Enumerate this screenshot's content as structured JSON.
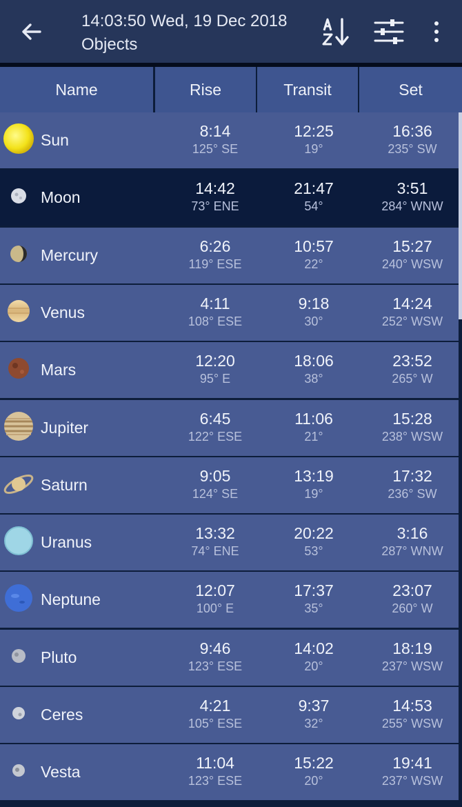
{
  "appbar": {
    "datetime": "14:03:50 Wed, 19 Dec 2018",
    "subtitle": "Objects",
    "back_icon": "arrow-left-icon",
    "sort_icon": "sort-az-icon",
    "filter_icon": "sliders-icon",
    "more_icon": "more-vert-icon"
  },
  "columns": [
    "Name",
    "Rise",
    "Transit",
    "Set"
  ],
  "rows": [
    {
      "name": "Sun",
      "icon": "sun-icon",
      "rise": "8:14",
      "rise_az": "125° SE",
      "transit": "12:25",
      "transit_alt": "19°",
      "set": "16:36",
      "set_az": "235° SW"
    },
    {
      "name": "Moon",
      "icon": "moon-icon",
      "rise": "14:42",
      "rise_az": "73° ENE",
      "transit": "21:47",
      "transit_alt": "54°",
      "set": "3:51",
      "set_az": "284° WNW",
      "selected": true
    },
    {
      "name": "Mercury",
      "icon": "mercury-icon",
      "rise": "6:26",
      "rise_az": "119° ESE",
      "transit": "10:57",
      "transit_alt": "22°",
      "set": "15:27",
      "set_az": "240° WSW"
    },
    {
      "name": "Venus",
      "icon": "venus-icon",
      "rise": "4:11",
      "rise_az": "108° ESE",
      "transit": "9:18",
      "transit_alt": "30°",
      "set": "14:24",
      "set_az": "252° WSW"
    },
    {
      "name": "Mars",
      "icon": "mars-icon",
      "rise": "12:20",
      "rise_az": "95° E",
      "transit": "18:06",
      "transit_alt": "38°",
      "set": "23:52",
      "set_az": "265° W"
    },
    {
      "name": "Jupiter",
      "icon": "jupiter-icon",
      "rise": "6:45",
      "rise_az": "122° ESE",
      "transit": "11:06",
      "transit_alt": "21°",
      "set": "15:28",
      "set_az": "238° WSW"
    },
    {
      "name": "Saturn",
      "icon": "saturn-icon",
      "rise": "9:05",
      "rise_az": "124° SE",
      "transit": "13:19",
      "transit_alt": "19°",
      "set": "17:32",
      "set_az": "236° SW"
    },
    {
      "name": "Uranus",
      "icon": "uranus-icon",
      "rise": "13:32",
      "rise_az": "74° ENE",
      "transit": "20:22",
      "transit_alt": "53°",
      "set": "3:16",
      "set_az": "287° WNW"
    },
    {
      "name": "Neptune",
      "icon": "neptune-icon",
      "rise": "12:07",
      "rise_az": "100° E",
      "transit": "17:37",
      "transit_alt": "35°",
      "set": "23:07",
      "set_az": "260° W"
    },
    {
      "name": "Pluto",
      "icon": "pluto-icon",
      "rise": "9:46",
      "rise_az": "123° ESE",
      "transit": "14:02",
      "transit_alt": "20°",
      "set": "18:19",
      "set_az": "237° WSW"
    },
    {
      "name": "Ceres",
      "icon": "ceres-icon",
      "rise": "4:21",
      "rise_az": "105° ESE",
      "transit": "9:37",
      "transit_alt": "32°",
      "set": "14:53",
      "set_az": "255° WSW"
    },
    {
      "name": "Vesta",
      "icon": "vesta-icon",
      "rise": "11:04",
      "rise_az": "123° ESE",
      "transit": "15:22",
      "transit_alt": "20°",
      "set": "19:41",
      "set_az": "237° WSW"
    }
  ],
  "colors": {
    "appbar": "#26365a",
    "row": "#485b93",
    "row_selected": "#0b1b3c",
    "header_cell": "#3e5590"
  }
}
